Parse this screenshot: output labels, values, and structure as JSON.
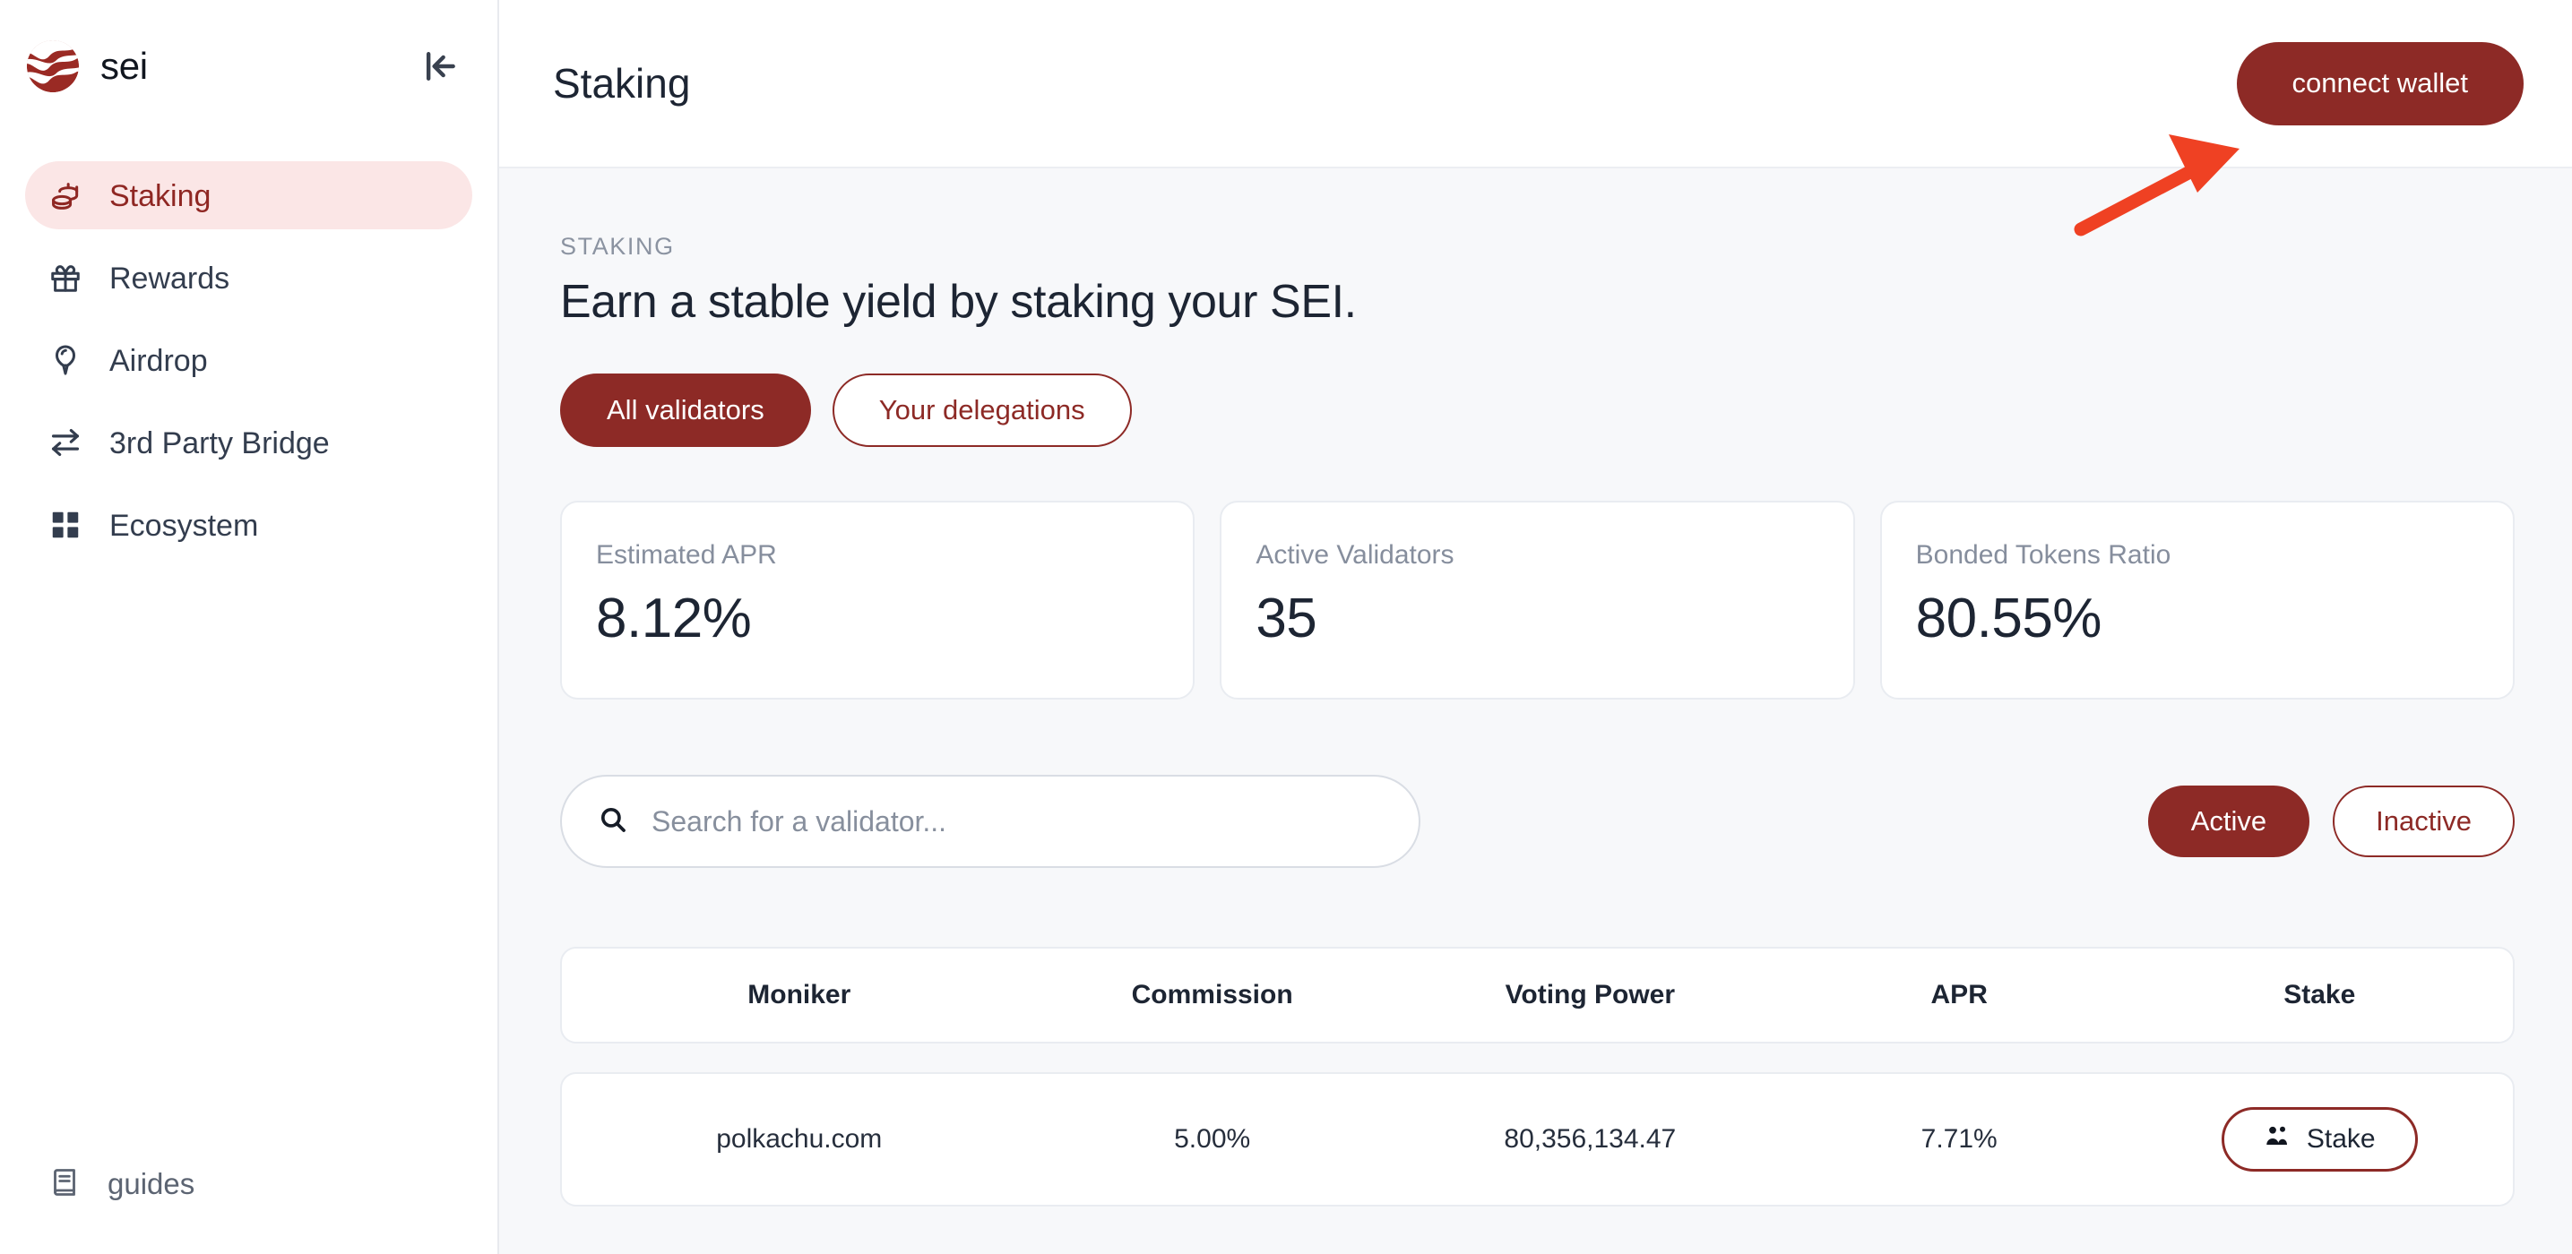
{
  "sidebar": {
    "brand": {
      "name": "sei",
      "logo_icon": "sei-logo-icon",
      "logo_color": "#9a2a24"
    },
    "collapse_icon": "collapse-left-icon",
    "items": [
      {
        "label": "Staking",
        "icon": "coins-icon",
        "active": true
      },
      {
        "label": "Rewards",
        "icon": "gift-icon",
        "active": false
      },
      {
        "label": "Airdrop",
        "icon": "balloon-icon",
        "active": false
      },
      {
        "label": "3rd Party Bridge",
        "icon": "swap-arrows-icon",
        "active": false
      },
      {
        "label": "Ecosystem",
        "icon": "grid-icon",
        "active": false
      }
    ],
    "footer": {
      "label": "guides",
      "icon": "book-icon"
    },
    "active_bg": "#fbe6e6",
    "active_fg": "#8f2723"
  },
  "topbar": {
    "title": "Staking",
    "connect_wallet_label": "connect wallet",
    "connect_wallet_color": "#8d2a26"
  },
  "main": {
    "eyebrow": "STAKING",
    "headline": "Earn a stable yield by staking your SEI.",
    "tabs": [
      {
        "label": "All validators",
        "selected": true
      },
      {
        "label": "Your delegations",
        "selected": false
      }
    ],
    "stats": [
      {
        "label": "Estimated APR",
        "value": "8.12%"
      },
      {
        "label": "Active Validators",
        "value": "35"
      },
      {
        "label": "Bonded Tokens Ratio",
        "value": "80.55%"
      }
    ],
    "search": {
      "placeholder": "Search for a validator...",
      "value": "",
      "icon": "search-icon"
    },
    "status_filters": [
      {
        "label": "Active",
        "selected": true
      },
      {
        "label": "Inactive",
        "selected": false
      }
    ],
    "table": {
      "columns": [
        "Moniker",
        "Commission",
        "Voting Power",
        "APR",
        "Stake"
      ],
      "rows": [
        {
          "moniker": "polkachu.com",
          "commission": "5.00%",
          "voting_power": "80,356,134.47",
          "apr": "7.71%",
          "stake_label": "Stake",
          "stake_icon": "users-icon"
        }
      ]
    }
  },
  "annotation": {
    "arrow_color": "#ef4123",
    "points_to": "connect-wallet-button"
  }
}
